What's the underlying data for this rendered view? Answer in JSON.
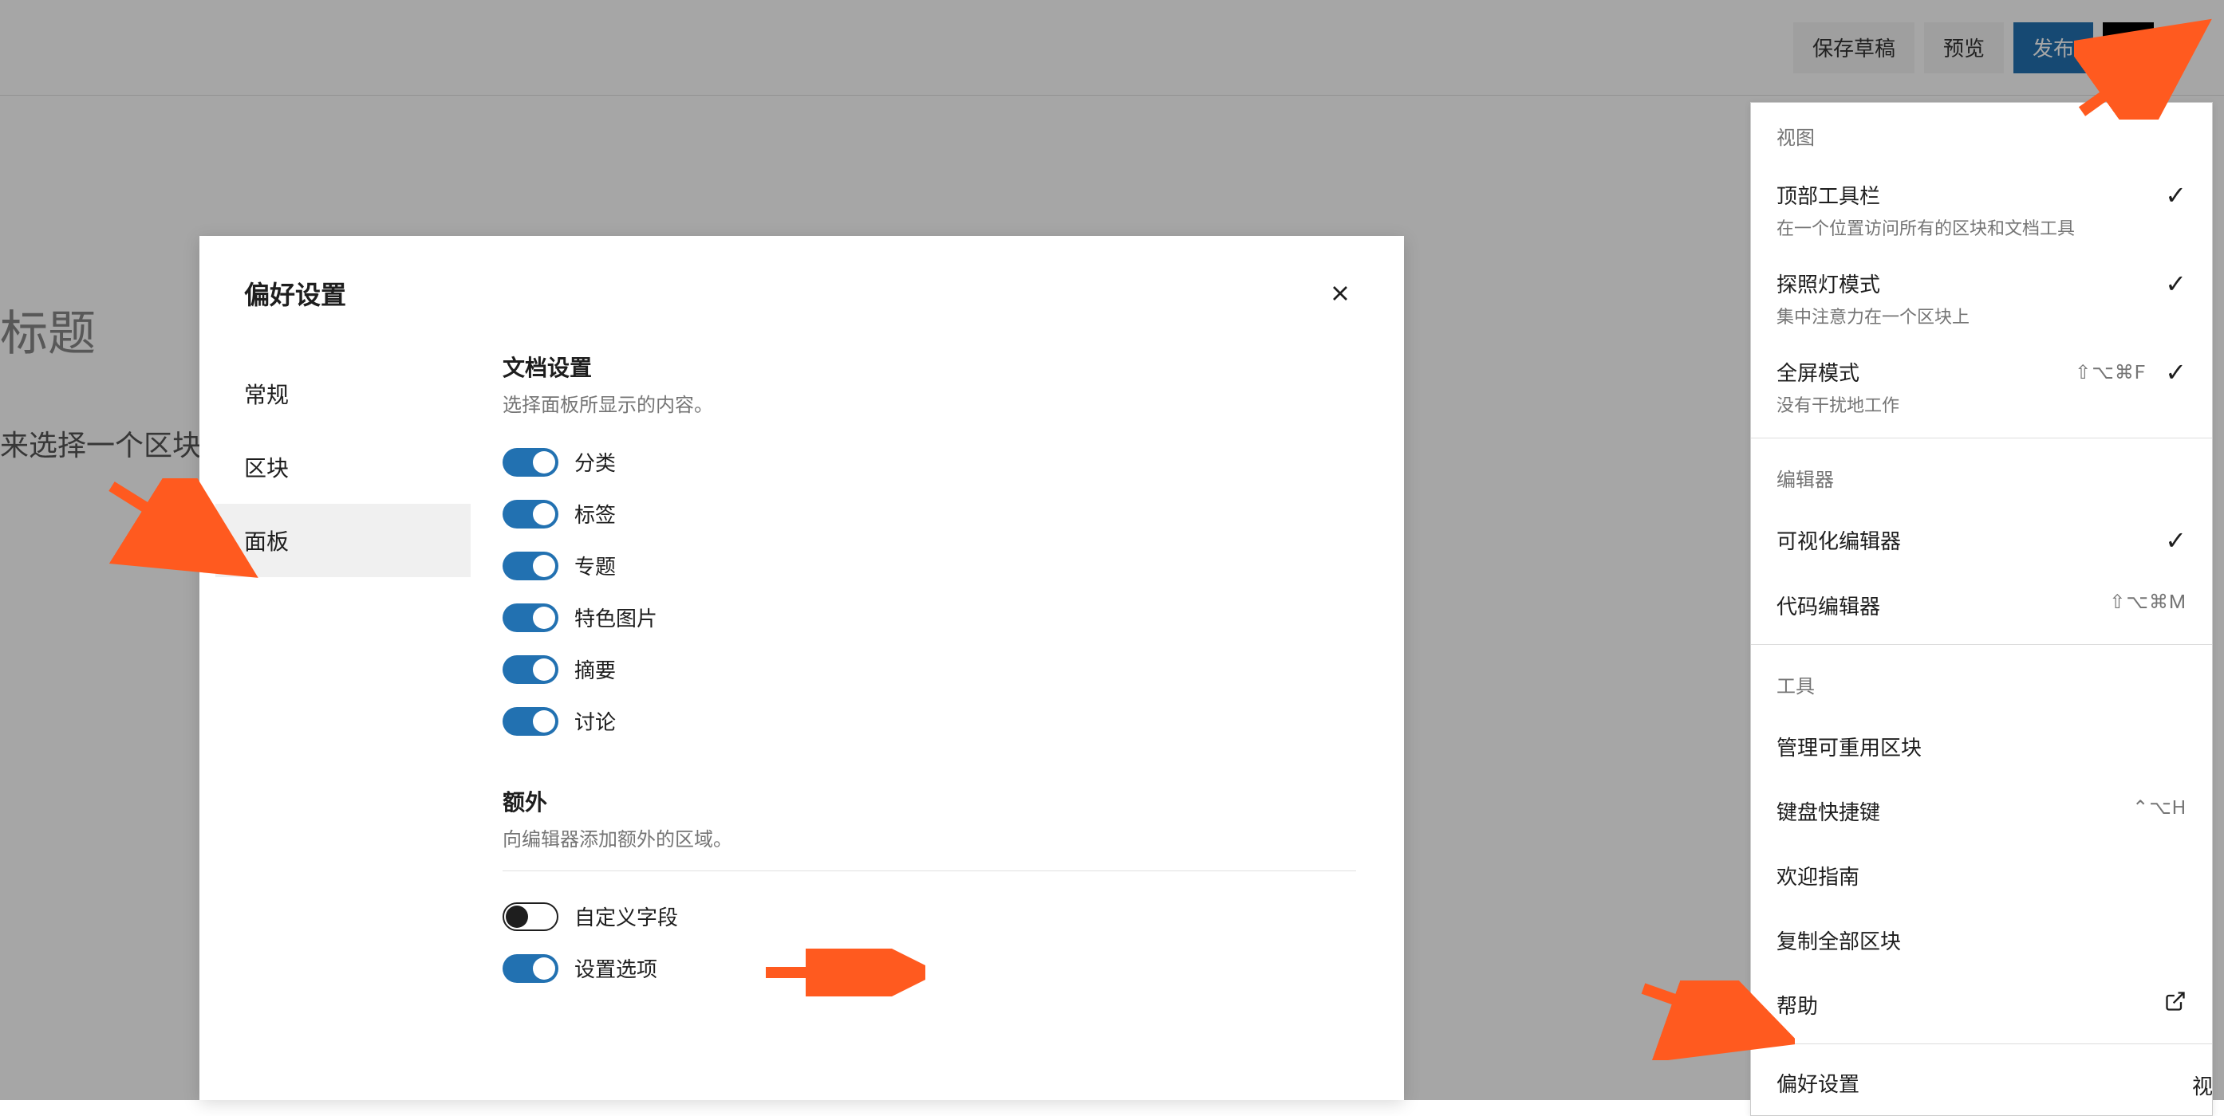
{
  "toolbar": {
    "save_draft": "保存草稿",
    "preview": "预览",
    "publish": "发布"
  },
  "background": {
    "title_placeholder": "标题",
    "block_hint": "来选择一个区块"
  },
  "dropdown": {
    "sections": {
      "view": "视图",
      "editor": "编辑器",
      "tools": "工具"
    },
    "items": {
      "top_toolbar": {
        "label": "顶部工具栏",
        "desc": "在一个位置访问所有的区块和文档工具"
      },
      "spotlight": {
        "label": "探照灯模式",
        "desc": "集中注意力在一个区块上"
      },
      "fullscreen": {
        "label": "全屏模式",
        "desc": "没有干扰地工作",
        "shortcut": "⇧⌥⌘F"
      },
      "visual_editor": {
        "label": "可视化编辑器"
      },
      "code_editor": {
        "label": "代码编辑器",
        "shortcut": "⇧⌥⌘M"
      },
      "manage_reusable": {
        "label": "管理可重用区块"
      },
      "keyboard_shortcuts": {
        "label": "键盘快捷键",
        "shortcut": "⌃⌥H"
      },
      "welcome_guide": {
        "label": "欢迎指南"
      },
      "copy_all": {
        "label": "复制全部区块"
      },
      "help": {
        "label": "帮助"
      },
      "preferences": {
        "label": "偏好设置"
      }
    },
    "truncated_text": "视"
  },
  "modal": {
    "title": "偏好设置",
    "tabs": {
      "general": "常规",
      "blocks": "区块",
      "panels": "面板"
    },
    "sections": {
      "document": {
        "title": "文档设置",
        "desc": "选择面板所显示的内容。",
        "toggles": {
          "category": "分类",
          "tags": "标签",
          "post_format": "专题",
          "featured_image": "特色图片",
          "excerpt": "摘要",
          "discussion": "讨论"
        }
      },
      "extra": {
        "title": "额外",
        "desc": "向编辑器添加额外的区域。",
        "toggles": {
          "custom_fields": "自定义字段",
          "settings_options": "设置选项"
        }
      }
    }
  }
}
